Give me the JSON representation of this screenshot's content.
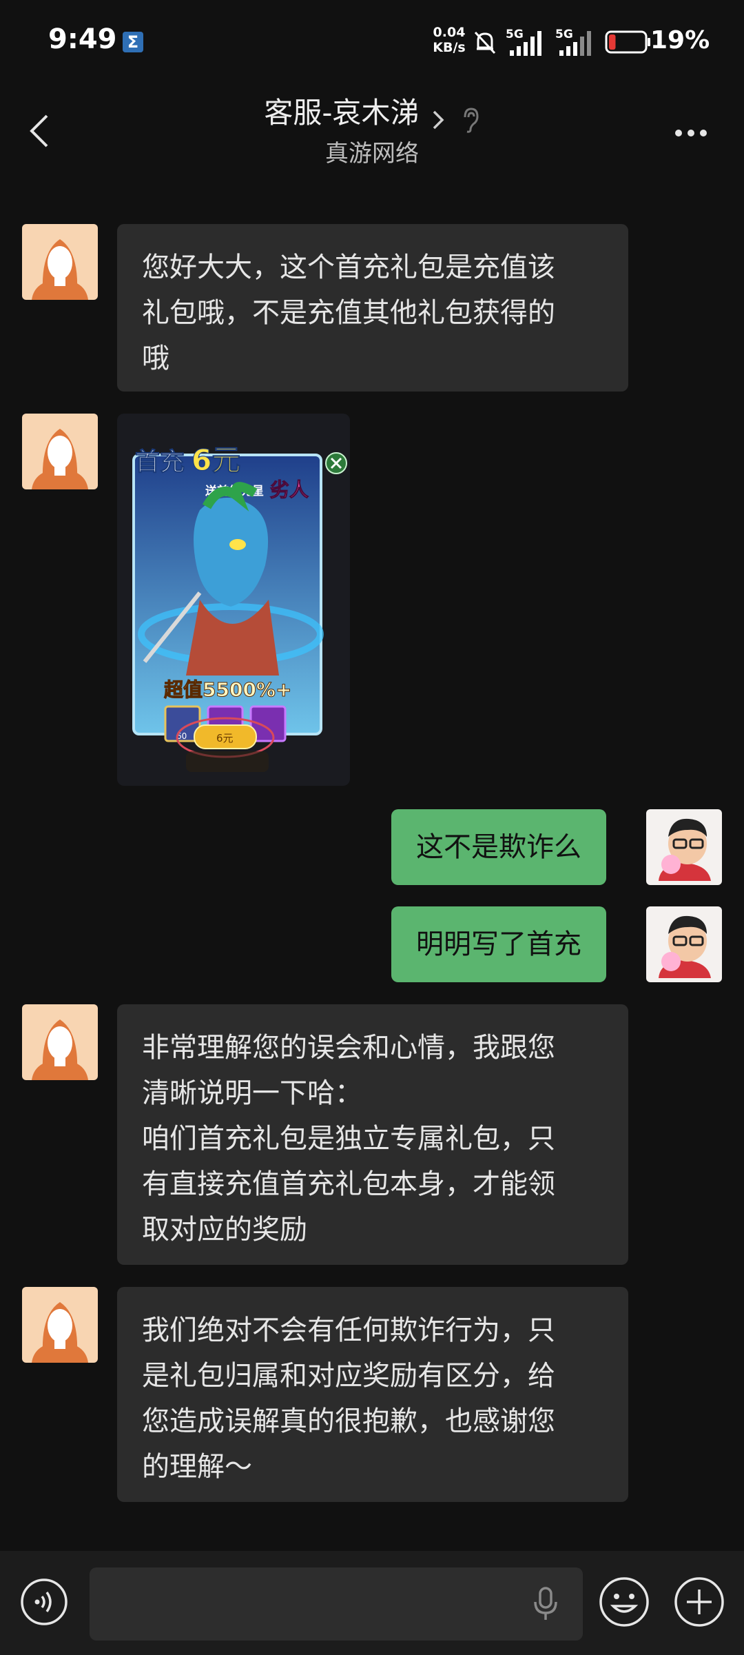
{
  "status_bar": {
    "time": "9:49",
    "net_speed_value": "0.04",
    "net_speed_unit": "KB/s",
    "signal_1_label": "5G",
    "signal_2_label": "5G",
    "battery": "19%",
    "battery_level": 0.19
  },
  "header": {
    "title": "客服-哀木涕",
    "subtitle": "真游网络"
  },
  "messages": [
    {
      "side": "in",
      "lines": [
        "您好大大，这个首充礼包是充值该",
        "礼包哦，不是充值其他礼包获得的",
        "哦"
      ]
    },
    {
      "side": "in",
      "type": "image",
      "image": {
        "title_main": "首充",
        "title_amount": "6元",
        "subtitle": "送首领克星",
        "hero_name": "劣人",
        "value_text": "超值5500%+",
        "item_count": "60",
        "price_button": "6元"
      }
    },
    {
      "side": "out",
      "text": "这不是欺诈么"
    },
    {
      "side": "out",
      "text": "明明写了首充"
    },
    {
      "side": "in",
      "lines": [
        "非常理解您的误会和心情，我跟您",
        "清晰说明一下哈：",
        "咱们首充礼包是独立专属礼包，只",
        "有直接充值首充礼包本身，才能领",
        "取对应的奖励"
      ]
    },
    {
      "side": "in",
      "lines": [
        "我们绝对不会有任何欺诈行为，只",
        "是礼包归属和对应奖励有区分，给",
        "您造成误解真的很抱歉，也感谢您",
        "的理解～"
      ]
    }
  ],
  "input_bar": {
    "placeholder": ""
  },
  "colors": {
    "background": "#111111",
    "incoming_bubble": "#2c2c2c",
    "outgoing_bubble": "#5bb56f"
  }
}
